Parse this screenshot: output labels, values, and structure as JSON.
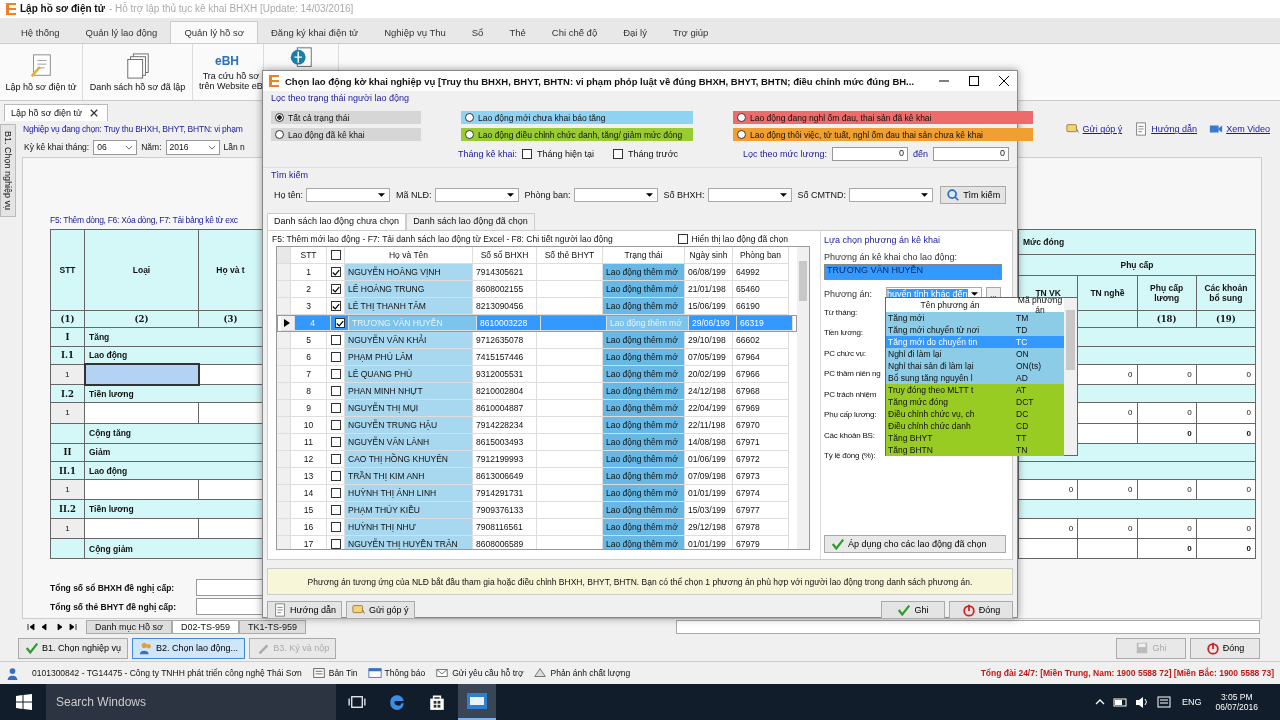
{
  "app": {
    "title": "Lập hồ sơ điện tử",
    "subtitle": " - Hỗ trợ lập thủ tục kê khai BHXH [Update: 14/03/2016]"
  },
  "menu_tabs": [
    {
      "label": "Hệ thống",
      "selected": false
    },
    {
      "label": "Quản lý lao động",
      "selected": false
    },
    {
      "label": "Quản lý hồ sơ",
      "selected": true
    },
    {
      "label": "Đăng ký khai điện tử",
      "selected": false
    },
    {
      "label": "Nghiệp vụ Thu",
      "selected": false
    },
    {
      "label": "Sổ",
      "selected": false
    },
    {
      "label": "Thẻ",
      "selected": false
    },
    {
      "label": "Chi chế độ",
      "selected": false
    },
    {
      "label": "Đại lý",
      "selected": false
    },
    {
      "label": "Trợ giúp",
      "selected": false
    }
  ],
  "ribbon": [
    {
      "lines": [
        "Lập hồ sơ điện tử"
      ]
    },
    {
      "lines": [
        "Danh sách hồ sơ đã lập"
      ]
    },
    {
      "logo": "eBH",
      "lines": [
        "Tra cứu hồ sơ",
        "trên Website eB"
      ]
    },
    {
      "kind": "icon-only"
    }
  ],
  "document_tab": {
    "label": "Lập hồ sơ điện tử"
  },
  "side_tab": {
    "label": "B1. Chọn nghiệp vụ"
  },
  "business": {
    "label": "Nghiệp vụ đang chọn: Truy thu BHXH, BHYT, BHTN: vi phạm",
    "month_label": "Kỳ kê khai tháng:",
    "month": "06",
    "year_label": "Năm:",
    "year": "2016",
    "times_label": "Lần n"
  },
  "help_links": [
    {
      "label": "Gửi góp ý"
    },
    {
      "label": "Hướng dẫn"
    },
    {
      "label": "Xem Video"
    }
  ],
  "form": {
    "hint": "F5: Thêm dòng, F6: Xóa dòng, F7: Tải bảng kê từ exc",
    "left_columns": [
      {
        "label": "STT",
        "number": "(1)"
      },
      {
        "label": "Loại",
        "number": "(2)"
      },
      {
        "label": "Họ và t",
        "number": "(3)"
      }
    ],
    "right_group": "Mức đóng",
    "right_subgroup": "Phụ cấp",
    "right_columns": [
      {
        "label": "TN VK"
      },
      {
        "label": "TN nghề"
      },
      {
        "label": "Phụ cấp lương",
        "number": "(18)"
      },
      {
        "label": "Các khoản bổ sung",
        "number": "(19)"
      }
    ],
    "rows": [
      {
        "kind": "section",
        "stt": "I",
        "label": "Tăng"
      },
      {
        "kind": "section",
        "stt": "I.1",
        "label": "Lao động"
      },
      {
        "kind": "entry",
        "stt": "1",
        "selected": true,
        "values": [
          "0",
          "0",
          "0"
        ]
      },
      {
        "kind": "section",
        "stt": "I.2",
        "label": "Tiền lương"
      },
      {
        "kind": "entry",
        "stt": "1",
        "selected": false,
        "values": [
          "0",
          "0",
          "0"
        ]
      },
      {
        "kind": "total",
        "label": "Cộng tăng",
        "values": [
          "0",
          "0"
        ]
      },
      {
        "kind": "section",
        "stt": "II",
        "label": "Giảm"
      },
      {
        "kind": "section",
        "stt": "II.1",
        "label": "Lao động"
      },
      {
        "kind": "entry",
        "stt": "1",
        "selected": false,
        "values": [
          "0",
          "0",
          "0",
          "0"
        ]
      },
      {
        "kind": "section",
        "stt": "II.2",
        "label": "Tiền lương"
      },
      {
        "kind": "entry",
        "stt": "1",
        "selected": false,
        "values": [
          "0",
          "0",
          "0",
          "0"
        ]
      },
      {
        "kind": "total",
        "label": "Cộng giảm",
        "values": [
          "0",
          "0"
        ]
      }
    ],
    "totals": [
      {
        "label": "Tổng số sổ BHXH đề nghị cấp:"
      },
      {
        "label": "Tổng số thẻ BHYT đề nghị cấp:"
      }
    ]
  },
  "sheet_tabs": [
    {
      "label": "Danh mục Hồ sơ",
      "selected": false
    },
    {
      "label": "D02-TS-959",
      "selected": true
    },
    {
      "label": "TK1-TS-959",
      "selected": false
    }
  ],
  "step_buttons": [
    {
      "label": "B1. Chọn nghiệp vụ",
      "selected": false,
      "disabled": false
    },
    {
      "label": "B2. Chọn lao động...",
      "selected": true,
      "disabled": false
    },
    {
      "label": "B3. Ký và nộp",
      "selected": false,
      "disabled": true
    }
  ],
  "action_buttons": [
    {
      "label": "Ghi",
      "disabled": true
    },
    {
      "label": "Đóng",
      "disabled": false
    }
  ],
  "status_bar": {
    "user": "0101300842 - TG14475 - Công ty TNHH phát triển công nghệ Thái Sơn",
    "links": [
      {
        "label": "Bản Tin"
      },
      {
        "label": "Thông báo"
      },
      {
        "label": "Gửi yêu cầu hỗ trợ"
      },
      {
        "label": "Phản ánh chất lượng"
      }
    ],
    "hotline": "Tổng đài 24/7: [Miền Trung, Nam: 1900 5588 72] [Miền Bắc: 1900 5588 73]"
  },
  "taskbar": {
    "search_placeholder": "Search Windows",
    "apps": [
      {
        "kind": "task-view",
        "active": false
      },
      {
        "kind": "edge",
        "active": false
      },
      {
        "kind": "store",
        "active": false
      },
      {
        "kind": "ebh",
        "active": true
      }
    ],
    "language": "ENG",
    "time": "3:05 PM",
    "date": "06/07/2016"
  },
  "dialog": {
    "title": "Chọn lao động kờ khai nghiệp vụ [Truy thu BHXH, BHYT, BHTN: vi phạm phỏp luật về đúng BHXH, BHYT, BHTN; điều chỉnh mức đúng BH...",
    "filter": {
      "heading": "Lọc theo trạng thái người lao động",
      "options": [
        {
          "label": "Tất cả trạng thái",
          "selected": true,
          "color": "#d6d6d6"
        },
        {
          "label": "Lao động mới chưa khai báo tăng",
          "selected": false,
          "color": "#8fd3f2"
        },
        {
          "label": "Lao động đang nghỉ ốm đau, thai sản đã kê khai",
          "selected": false,
          "color": "#ee6b6b"
        },
        {
          "label": "Lao động đã kê khai",
          "selected": false,
          "color": "#d6d6d6"
        },
        {
          "label": "Lao động điều chỉnh chức danh, tăng/ giảm mức đóng",
          "selected": false,
          "color": "#99cc33"
        },
        {
          "label": "Lao động thôi việc, tử tuất, nghỉ ốm đau thai sản chưa kê khai",
          "selected": false,
          "color": "#f0a030"
        }
      ],
      "month_label": "Tháng kê khai:",
      "month_checks": [
        {
          "label": "Tháng hiện tại",
          "checked": false
        },
        {
          "label": "Tháng trước",
          "checked": false
        }
      ],
      "salary_label": "Lọc theo mức lương:",
      "salary_from": "0",
      "to_label": "đến",
      "salary_to": "0"
    },
    "search": {
      "heading": "Tìm kiếm",
      "fields": [
        {
          "label": "Họ tên:"
        },
        {
          "label": "Mã NLĐ:"
        },
        {
          "label": "Phòng ban:"
        },
        {
          "label": "Số BHXH:"
        },
        {
          "label": "Số CMTND:"
        }
      ],
      "button": "Tìm kiếm"
    },
    "tabs": [
      {
        "label": "Danh sách lao động chưa chọn",
        "selected": true
      },
      {
        "label": "Danh sách lao động đã chọn",
        "selected": false
      }
    ],
    "list": {
      "hint": "F5: Thêm mới lao động - F7: Tải danh sách lao động từ Excel - F8: Chi tiết người lao động",
      "show_selected": {
        "label": "Hiển thị  lao động đã chọn",
        "checked": false
      },
      "check_all": false,
      "columns": [
        "STT",
        "Họ và Tên",
        "Số sổ BHXH",
        "Số thẻ BHYT",
        "Trạng thái",
        "Ngày sinh",
        "Phòng ban"
      ],
      "rows": [
        {
          "stt": "1",
          "checked": true,
          "selected": false,
          "name": "NGUYỄN HOÀNG VỊNH",
          "bhxh": "7914305621",
          "status": "Lao động thêm mớ",
          "dob": "06/08/199",
          "dept": "64992"
        },
        {
          "stt": "2",
          "checked": true,
          "selected": false,
          "name": "LÊ HOÀNG TRUNG",
          "bhxh": "8608002155",
          "status": "Lao động thêm mớ",
          "dob": "21/01/198",
          "dept": "65460"
        },
        {
          "stt": "3",
          "checked": true,
          "selected": false,
          "name": "LÊ THỊ THANH TÂM",
          "bhxh": "8213090456",
          "status": "Lao động thêm mớ",
          "dob": "15/06/199",
          "dept": "66190"
        },
        {
          "stt": "4",
          "checked": true,
          "selected": true,
          "name": "TRƯƠNG VĂN HUYỀN",
          "bhxh": "8610003228",
          "status": "Lao động thêm mớ",
          "dob": "29/06/199",
          "dept": "66319"
        },
        {
          "stt": "5",
          "checked": false,
          "selected": false,
          "name": "NGUYỄN VĂN KHẢI",
          "bhxh": "9712635078",
          "status": "Lao động thêm mớ",
          "dob": "29/10/198",
          "dept": "66602"
        },
        {
          "stt": "6",
          "checked": false,
          "selected": false,
          "name": "PHẠM PHÚ LÂM",
          "bhxh": "7415157446",
          "status": "Lao động thêm mớ",
          "dob": "07/05/199",
          "dept": "67964"
        },
        {
          "stt": "7",
          "checked": false,
          "selected": false,
          "name": "LÊ QUANG PHÚ",
          "bhxh": "9312005531",
          "status": "Lao động thêm mớ",
          "dob": "20/02/199",
          "dept": "67966"
        },
        {
          "stt": "8",
          "checked": false,
          "selected": false,
          "name": "PHAN MINH NHỰT",
          "bhxh": "8210002804",
          "status": "Lao động thêm mớ",
          "dob": "24/12/198",
          "dept": "67968"
        },
        {
          "stt": "9",
          "checked": false,
          "selected": false,
          "name": "NGUYỄN THỊ MỤI",
          "bhxh": "8610004887",
          "status": "Lao động thêm mớ",
          "dob": "22/04/199",
          "dept": "67969"
        },
        {
          "stt": "10",
          "checked": false,
          "selected": false,
          "name": "NGUYỄN TRUNG HẬU",
          "bhxh": "7914228234",
          "status": "Lao động thêm mớ",
          "dob": "22/11/198",
          "dept": "67970"
        },
        {
          "stt": "11",
          "checked": false,
          "selected": false,
          "name": "NGUYỄN VĂN LÀNH",
          "bhxh": "8615003493",
          "status": "Lao động thêm mớ",
          "dob": "14/08/198",
          "dept": "67971"
        },
        {
          "stt": "12",
          "checked": false,
          "selected": false,
          "name": "CAO THỊ HỒNG KHUYÊN",
          "bhxh": "7912199993",
          "status": "Lao động thêm mớ",
          "dob": "01/06/199",
          "dept": "67972"
        },
        {
          "stt": "13",
          "checked": false,
          "selected": false,
          "name": "TRẦN THỊ KIM ANH",
          "bhxh": "8613006649",
          "status": "Lao động thêm mớ",
          "dob": "07/09/198",
          "dept": "67973"
        },
        {
          "stt": "14",
          "checked": false,
          "selected": false,
          "name": "HUỲNH THỊ ÁNH LINH",
          "bhxh": "7914291731",
          "status": "Lao động thêm mớ",
          "dob": "01/01/199",
          "dept": "67974"
        },
        {
          "stt": "15",
          "checked": false,
          "selected": false,
          "name": "PHẠM THÚY KIỀU",
          "bhxh": "7909376133",
          "status": "Lao động thêm mớ",
          "dob": "15/03/199",
          "dept": "67977"
        },
        {
          "stt": "16",
          "checked": false,
          "selected": false,
          "name": "HUỲNH THỊ NHƯ",
          "bhxh": "7908116561",
          "status": "Lao động thêm mớ",
          "dob": "29/12/198",
          "dept": "67978"
        },
        {
          "stt": "17",
          "checked": false,
          "selected": false,
          "name": "NGUYỄN THỊ HUYỀN TRÂN",
          "bhxh": "8608006589",
          "status": "Lao động thêm mớ",
          "dob": "01/01/199",
          "dept": "67979"
        }
      ]
    },
    "plan": {
      "heading": "Lựa chọn phương án kê khai",
      "employee_label": "Phương án kê khai cho lao động:",
      "employee": "TRƯƠNG VĂN HUYỀN",
      "plan_label": "Phương án:",
      "plan_value": "huyển tỉnh khác đến",
      "browse_button": "...",
      "fields": [
        "Từ tháng:",
        "Tiền lương:",
        "PC chức vụ:",
        "PC thâm niên ng",
        "PC trách nhiệm",
        "Phụ cấp lương:",
        "Các khoản BS:",
        "Tỷ lệ đóng (%):"
      ],
      "apply_button": "Áp dụng cho các lao động đã chọn"
    },
    "dropdown": {
      "columns": [
        "Tên phương án",
        "Mã phương án"
      ],
      "items": [
        {
          "name": "Tăng mới",
          "code": "TM",
          "color": "#8ccce6",
          "selected": false
        },
        {
          "name": "Tăng mới chuyển từ nơi",
          "code": "TD",
          "color": "#8ccce6",
          "selected": false
        },
        {
          "name": "Tăng mới do chuyển tin",
          "code": "TC",
          "selected": true
        },
        {
          "name": "Nghỉ đi làm lại",
          "code": "ON",
          "color": "#8ccce6",
          "selected": false
        },
        {
          "name": " Nghỉ thai sản đi làm lại",
          "code": "ON(ts)",
          "color": "#8ccce6",
          "selected": false
        },
        {
          "name": "Bổ sung tăng nguyên l",
          "code": "AD",
          "color": "#8ccce6",
          "selected": false
        },
        {
          "name": "Truy đóng theo MLTT t",
          "code": "AT",
          "color": "#99cc22",
          "selected": false
        },
        {
          "name": "Tăng mức đóng",
          "code": "DCT",
          "color": "#99cc22",
          "selected": false
        },
        {
          "name": "Điều chỉnh chức vụ, ch",
          "code": "DC",
          "color": "#99cc22",
          "selected": false
        },
        {
          "name": "Điều chỉnh chức danh",
          "code": "CD",
          "color": "#99cc22",
          "selected": false
        },
        {
          "name": "Tăng BHYT",
          "code": "TT",
          "color": "#99cc22",
          "selected": false
        },
        {
          "name": "Tăng BHTN",
          "code": "TN",
          "color": "#99cc22",
          "selected": false
        }
      ]
    },
    "info": "Phương án tương ứng của NLĐ bắt đầu tham gia hoặc điều chỉnh BHXH, BHYT, BHTN. Bạn có thể chọn 1 phương án phù hợp với người lao động trong danh sách phương án.",
    "left_buttons": [
      {
        "label": "Hướng dẫn"
      },
      {
        "label": "Gửi góp ý"
      }
    ],
    "right_buttons": [
      {
        "label": "Ghi"
      },
      {
        "label": "Đóng"
      }
    ]
  }
}
